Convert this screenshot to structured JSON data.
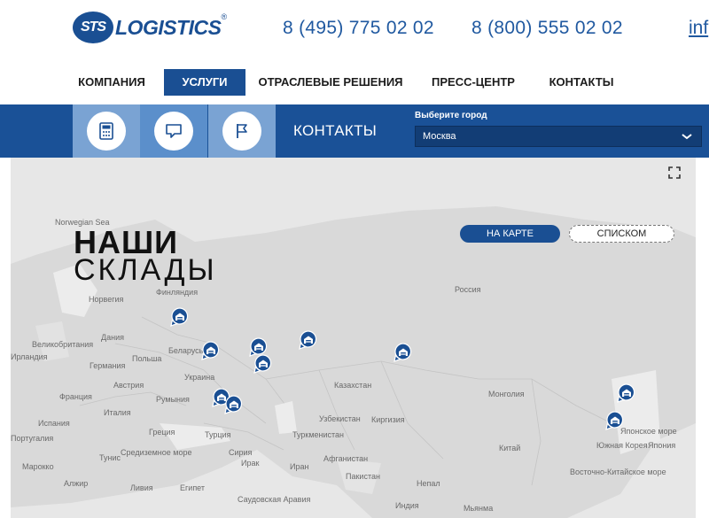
{
  "header": {
    "logo_badge": "STS",
    "logo_text": "LOGISTICS",
    "logo_reg": "®",
    "phone_1": "8 (495) 775 02 02",
    "phone_2": "8 (800) 555 02 02",
    "info_link": "inf"
  },
  "nav": {
    "items": [
      {
        "label": "КОМПАНИЯ"
      },
      {
        "label": "УСЛУГИ",
        "active": true
      },
      {
        "label": "ОТРАСЛЕВЫЕ РЕШЕНИЯ"
      },
      {
        "label": "ПРЕСС-ЦЕНТР"
      },
      {
        "label": "КОНТАКТЫ"
      }
    ]
  },
  "toolbar": {
    "tools": [
      "calculator-icon",
      "chat-icon",
      "flag-icon"
    ],
    "section_title": "КОНТАКТЫ",
    "city_label": "Выберите город",
    "city_value": "Москва"
  },
  "map": {
    "heading_line1": "НАШИ",
    "heading_line2": "СКЛАДЫ",
    "view_map": "НА КАРТЕ",
    "view_list": "СПИСКОМ",
    "labels": {
      "norwegian_sea": "Norwegian Sea",
      "finland": "Финляндия",
      "norway": "Норвегия",
      "russia": "Россия",
      "uk": "Великобритания",
      "ireland": "Ирландия",
      "denmark": "Дания",
      "poland": "Польша",
      "belarus": "Беларусь",
      "germany": "Германия",
      "austria": "Австрия",
      "ukraine": "Украина",
      "france": "Франция",
      "romania": "Румыния",
      "italy": "Италия",
      "kazakhstan": "Казахстан",
      "mongolia": "Монголия",
      "spain": "Испания",
      "portugal": "Португалия",
      "greece": "Греция",
      "turkey": "Турция",
      "uzbekistan": "Узбекистан",
      "kyrgyzstan": "Киргизия",
      "turkmenistan": "Туркменистан",
      "china": "Китай",
      "south_korea": "Южная Корея",
      "japan": "Япония",
      "sea_of_japan": "Японское море",
      "mediterranean": "Средиземное море",
      "tunisia": "Тунис",
      "syria": "Сирия",
      "iraq": "Ирак",
      "iran": "Иран",
      "afghanistan": "Афганистан",
      "pakistan": "Пакистан",
      "nepal": "Непал",
      "east_china_sea": "Восточно-Китайское море",
      "morocco": "Марокко",
      "algeria": "Алжир",
      "libya": "Ливия",
      "egypt": "Египет",
      "saudi_arabia": "Саудовская Аравия",
      "india": "Индия",
      "myanmar": "Мьянма"
    },
    "marker_icon": "warehouse-marker-icon",
    "marker_color": "#1a4f93"
  },
  "colors": {
    "brand_blue": "#1a4f93",
    "toolbar_blue": "#1a5197",
    "map_bg": "#ececec"
  }
}
